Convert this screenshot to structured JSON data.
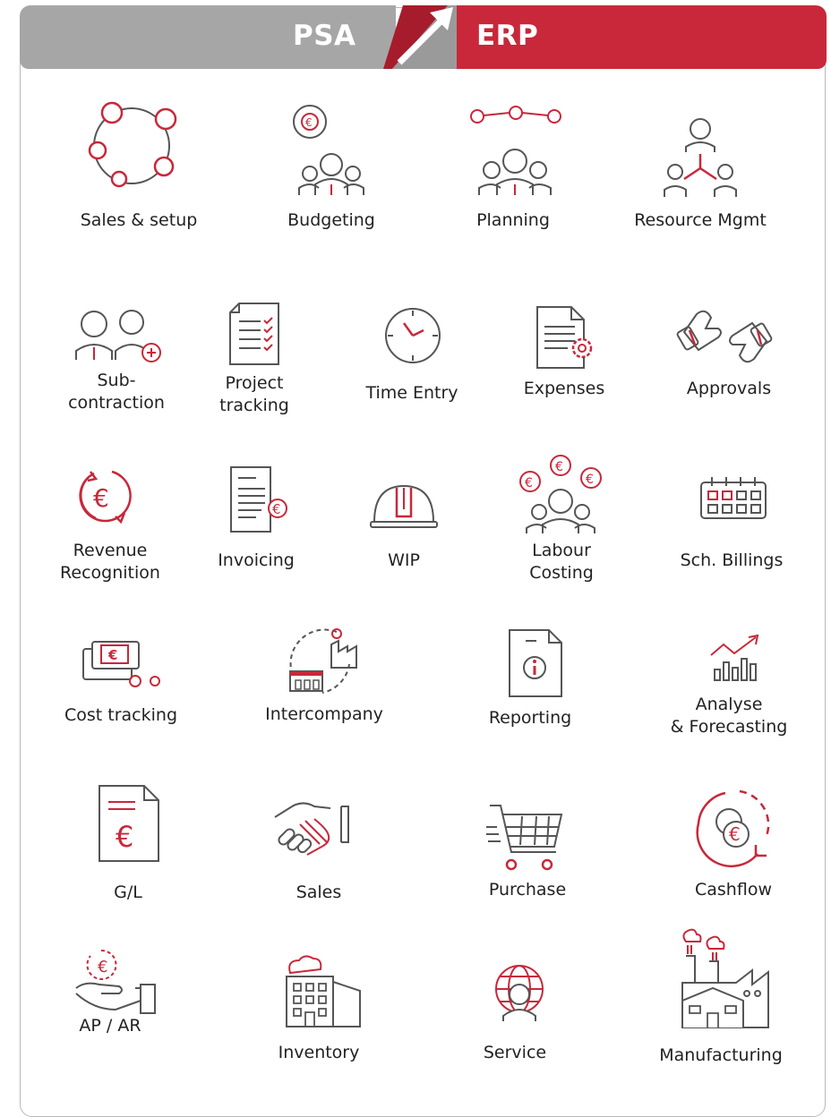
{
  "header": {
    "left_label": "PSA",
    "right_label": "ERP"
  },
  "colors": {
    "red": "#c8283a",
    "grey": "#a6a6a6",
    "icon_stroke": "#555555"
  },
  "items": [
    {
      "label": "Sales & setup",
      "icon": "cycle-icon"
    },
    {
      "label": "Budgeting",
      "icon": "team-euro-icon"
    },
    {
      "label": "Planning",
      "icon": "team-timeline-icon"
    },
    {
      "label": "Resource Mgmt",
      "icon": "resource-hierarchy-icon"
    },
    {
      "label_lines": [
        "Sub-",
        "contraction"
      ],
      "icon": "subcontractor-icon"
    },
    {
      "label_lines": [
        "Project",
        "tracking"
      ],
      "icon": "checklist-icon"
    },
    {
      "label": "Time Entry",
      "icon": "clock-icon"
    },
    {
      "label": "Expenses",
      "icon": "expense-document-icon"
    },
    {
      "label": "Approvals",
      "icon": "thumbs-icon"
    },
    {
      "label_lines": [
        "Revenue",
        "Recognition"
      ],
      "icon": "euro-cycle-icon"
    },
    {
      "label": "Invoicing",
      "icon": "invoice-icon"
    },
    {
      "label": "WIP",
      "icon": "hard-hat-icon"
    },
    {
      "label_lines": [
        "Labour",
        "Costing"
      ],
      "icon": "labour-euro-icon"
    },
    {
      "label": "Sch. Billings",
      "icon": "calendar-icon"
    },
    {
      "label": "Cost tracking",
      "icon": "cost-card-icon"
    },
    {
      "label": "Intercompany",
      "icon": "intercompany-icon"
    },
    {
      "label": "Reporting",
      "icon": "report-info-icon"
    },
    {
      "label_lines": [
        "Analyse",
        "& Forecasting"
      ],
      "icon": "bar-trend-icon"
    },
    {
      "label": "G/L",
      "icon": "ledger-euro-icon"
    },
    {
      "label": "Sales",
      "icon": "handshake-icon"
    },
    {
      "label": "Purchase",
      "icon": "cart-icon"
    },
    {
      "label": "Cashflow",
      "icon": "coins-cycle-icon"
    },
    {
      "label": "AP / AR",
      "icon": "hand-euro-icon"
    },
    {
      "label": "Inventory",
      "icon": "warehouse-icon"
    },
    {
      "label": "Service",
      "icon": "globe-agent-icon"
    },
    {
      "label": "Manufacturing",
      "icon": "factory-icon"
    }
  ]
}
